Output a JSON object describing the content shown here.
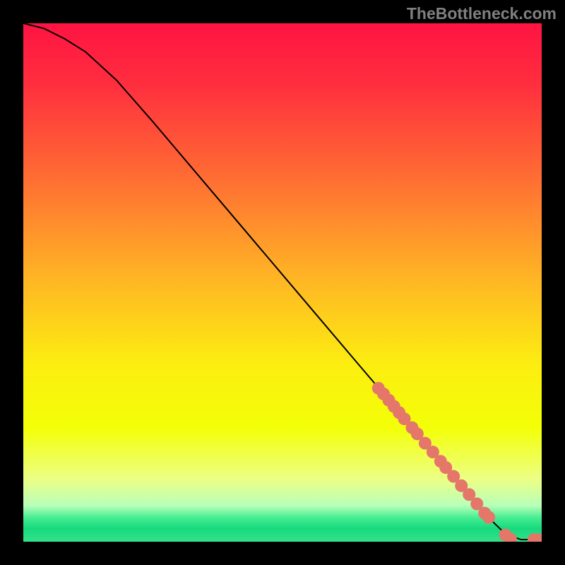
{
  "watermark": "TheBottleneck.com",
  "colors": {
    "background": "#000000",
    "watermark": "#808080",
    "curve": "#000000",
    "marker": "#e4766a",
    "gradient_stops": [
      {
        "offset": 0,
        "color": "#ff1342"
      },
      {
        "offset": 0.12,
        "color": "#ff2f3e"
      },
      {
        "offset": 0.3,
        "color": "#ff6e33"
      },
      {
        "offset": 0.5,
        "color": "#ffb824"
      },
      {
        "offset": 0.66,
        "color": "#fcee10"
      },
      {
        "offset": 0.78,
        "color": "#f3ff07"
      },
      {
        "offset": 0.88,
        "color": "#ecff86"
      },
      {
        "offset": 0.93,
        "color": "#b9ffb9"
      },
      {
        "offset": 0.955,
        "color": "#41ec90"
      },
      {
        "offset": 0.975,
        "color": "#17d97d"
      },
      {
        "offset": 1.0,
        "color": "#34e28a"
      }
    ]
  },
  "chart_data": {
    "type": "line",
    "title": "",
    "xlabel": "",
    "ylabel": "",
    "xlim": [
      0,
      100
    ],
    "ylim": [
      0,
      100
    ],
    "curve": {
      "x": [
        0,
        4,
        8,
        12,
        18,
        25,
        35,
        45,
        55,
        65,
        72,
        78,
        83,
        87,
        90,
        93,
        96,
        100
      ],
      "y": [
        100,
        99,
        97,
        94.5,
        89,
        81,
        69.2,
        57.4,
        45.6,
        33.8,
        25.6,
        18.5,
        12.6,
        7.9,
        4.4,
        1.5,
        0.4,
        0.4
      ]
    },
    "markers": {
      "x": [
        68.5,
        69.5,
        70.5,
        71.5,
        72.5,
        73.5,
        75.0,
        76.0,
        77.5,
        79.0,
        80.5,
        81.5,
        83.0,
        84.5,
        86.0,
        87.5,
        89.0,
        89.8,
        93.0,
        94.0,
        98.5,
        99.5
      ],
      "y": [
        29.6,
        28.5,
        27.3,
        26.1,
        24.9,
        23.7,
        22.0,
        20.8,
        19.0,
        17.3,
        15.5,
        14.3,
        12.6,
        10.8,
        9.1,
        7.3,
        5.5,
        4.7,
        1.3,
        0.5,
        0.4,
        0.4
      ]
    }
  }
}
